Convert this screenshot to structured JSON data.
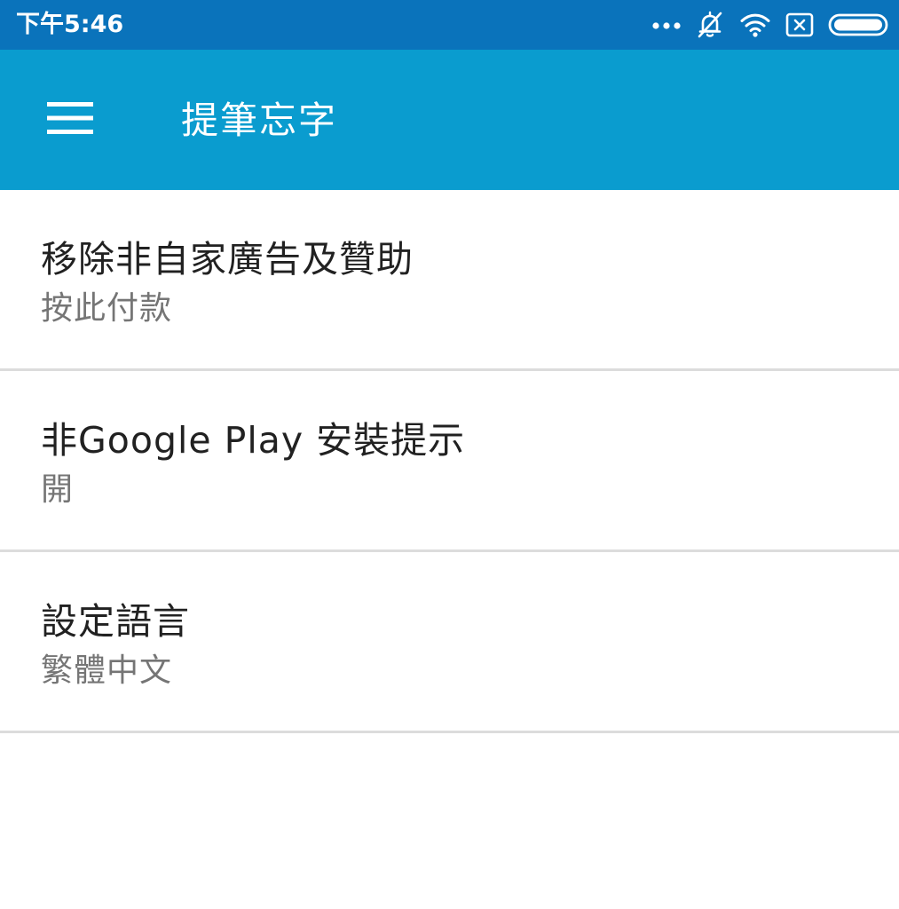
{
  "status_bar": {
    "time": "下午5:46",
    "icons": [
      "more-dots-icon",
      "alarm-off-icon",
      "wifi-icon",
      "sim-x-icon",
      "battery-icon"
    ],
    "background_color": "#0a73bb"
  },
  "app_bar": {
    "title": "提筆忘字",
    "menu_icon": "hamburger-menu-icon",
    "background_color": "#0a9ccf"
  },
  "settings": {
    "items": [
      {
        "title": "移除非自家廣告及贊助",
        "summary": "按此付款"
      },
      {
        "title": "非Google Play 安裝提示",
        "summary": "開"
      },
      {
        "title": "設定語言",
        "summary": "繁體中文"
      }
    ]
  }
}
